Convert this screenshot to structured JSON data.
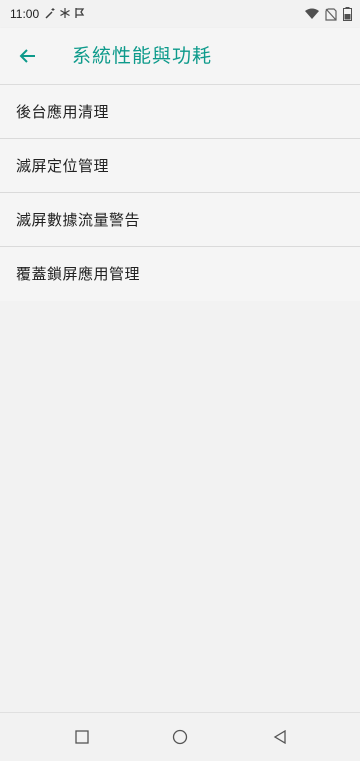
{
  "status_bar": {
    "time": "11:00",
    "icons_left": [
      "wand-icon",
      "snowflake-icon",
      "flag-icon"
    ],
    "icons_right": [
      "wifi-icon",
      "no-sim-icon",
      "battery-icon"
    ]
  },
  "app_bar": {
    "back_icon": "arrow-left-icon",
    "title": "系統性能與功耗",
    "accent": "#0d9a8b"
  },
  "list": {
    "items": [
      {
        "label": "後台應用清理"
      },
      {
        "label": "滅屏定位管理"
      },
      {
        "label": "滅屏數據流量警告"
      },
      {
        "label": "覆蓋鎖屏應用管理"
      }
    ]
  },
  "nav_bar": {
    "buttons": [
      "recent-apps-icon",
      "home-icon",
      "back-triangle-icon"
    ]
  }
}
